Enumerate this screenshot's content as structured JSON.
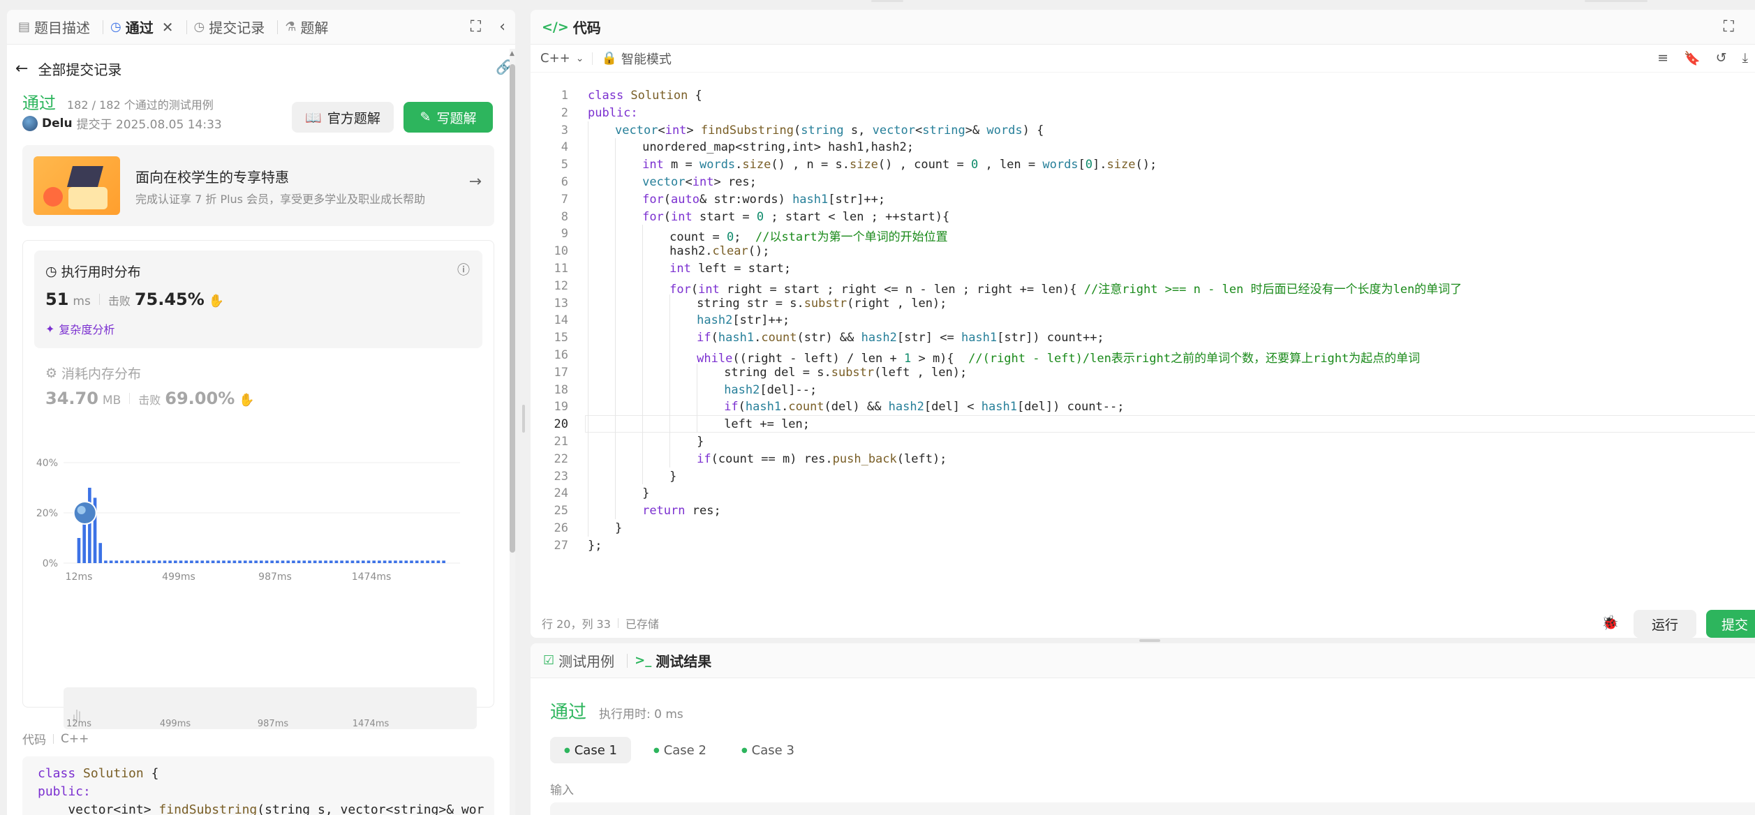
{
  "left": {
    "tabs": [
      {
        "label": "题目描述",
        "icon": "document-icon"
      },
      {
        "label": "通过",
        "icon": "history-icon",
        "active": true,
        "closable": true
      },
      {
        "label": "提交记录",
        "icon": "history-icon"
      },
      {
        "label": "题解",
        "icon": "flask-icon"
      }
    ],
    "back_label": "全部提交记录",
    "status": "通过",
    "cases_info": "182 / 182 个通过的测试用例",
    "user": "Delu",
    "submitted_at": "提交于 2025.08.05 14:33",
    "official_btn": "官方题解",
    "write_btn": "写题解",
    "promo": {
      "title": "面向在校学生的专享特惠",
      "subtitle": "完成认证享 7 折 Plus 会员，享受更多学业及职业成长帮助"
    },
    "runtime": {
      "title": "执行用时分布",
      "value": "51",
      "unit": "ms",
      "beat_label": "击败",
      "beat": "75.45%",
      "complexity_link": "复杂度分析"
    },
    "memory": {
      "title": "消耗内存分布",
      "value": "34.70",
      "unit": "MB",
      "beat_label": "击败",
      "beat": "69.00%"
    },
    "code_section_label": "代码",
    "code_section_lang": "C++",
    "preview": [
      [
        [
          "class ",
          "kw"
        ],
        [
          "Solution",
          "fn"
        ],
        [
          " {",
          ""
        ]
      ],
      [
        [
          "public:",
          "kw"
        ]
      ],
      [
        [
          "    vector<int> ",
          ""
        ],
        [
          "findSubstring",
          "fn"
        ],
        [
          "(string s, vector<string>& wor",
          ""
        ]
      ]
    ]
  },
  "chart_data": {
    "type": "bar",
    "title": "执行用时分布",
    "x_tick_labels": [
      "12ms",
      "499ms",
      "987ms",
      "1474ms"
    ],
    "y_tick_labels": [
      "40%",
      "20%",
      "0%"
    ],
    "ylim": [
      0,
      40
    ],
    "user_value_ms": 51,
    "bins": 70,
    "values": [
      0,
      10,
      18,
      30,
      26,
      8,
      1,
      1,
      1,
      1,
      1,
      1,
      1,
      1,
      1,
      1,
      1,
      1,
      1,
      1,
      1,
      1,
      1,
      1,
      1,
      1,
      1,
      1,
      1,
      1,
      1,
      1,
      1,
      1,
      1,
      1,
      1,
      1,
      1,
      1,
      1,
      1,
      1,
      1,
      1,
      1,
      1,
      1,
      1,
      1,
      1,
      1,
      1,
      1,
      1,
      1,
      1,
      1,
      1,
      1,
      1,
      1,
      1,
      1,
      1,
      1,
      1,
      1,
      1,
      1
    ],
    "overview_tick_labels": [
      "12ms",
      "499ms",
      "987ms",
      "1474ms"
    ],
    "accent_color": "#3c72e6"
  },
  "editor": {
    "title": "代码",
    "lang": "C++",
    "mode": "智能模式",
    "status_pos": "行 20，列 33",
    "status_saved": "已存储",
    "run_btn": "运行",
    "submit_btn": "提交",
    "active_line": 20,
    "lines": [
      {
        "indent": 0,
        "t": [
          [
            "class ",
            "kw"
          ],
          [
            "Solution",
            "fn"
          ],
          [
            " {",
            ""
          ]
        ]
      },
      {
        "indent": 0,
        "t": [
          [
            "public:",
            "kw"
          ]
        ]
      },
      {
        "indent": 1,
        "t": [
          [
            "vector",
            "ty"
          ],
          [
            "<",
            ""
          ],
          [
            "int",
            "kw"
          ],
          [
            "> ",
            ""
          ],
          [
            "findSubstring",
            "fn"
          ],
          [
            "(",
            ""
          ],
          [
            "string",
            "ty"
          ],
          [
            " s, ",
            ""
          ],
          [
            "vector",
            "ty"
          ],
          [
            "<",
            ""
          ],
          [
            "string",
            "ty"
          ],
          [
            ">& ",
            ""
          ],
          [
            "words",
            "ty"
          ],
          [
            ") {",
            ""
          ]
        ]
      },
      {
        "indent": 2,
        "t": [
          [
            "unordered_map<string,int> hash1,hash2;",
            ""
          ]
        ]
      },
      {
        "indent": 2,
        "t": [
          [
            "int",
            "kw"
          ],
          [
            " m = ",
            ""
          ],
          [
            "words",
            "ty"
          ],
          [
            ".",
            ""
          ],
          [
            "size",
            "fn"
          ],
          [
            "() , n = s.",
            ""
          ],
          [
            "size",
            "fn"
          ],
          [
            "() , count = ",
            ""
          ],
          [
            "0",
            "num"
          ],
          [
            " , len = ",
            ""
          ],
          [
            "words",
            "ty"
          ],
          [
            "[",
            ""
          ],
          [
            "0",
            "num"
          ],
          [
            "].",
            ""
          ],
          [
            "size",
            "fn"
          ],
          [
            "();",
            ""
          ]
        ]
      },
      {
        "indent": 2,
        "t": [
          [
            "vector",
            "ty"
          ],
          [
            "<",
            ""
          ],
          [
            "int",
            "kw"
          ],
          [
            "> res;",
            ""
          ]
        ]
      },
      {
        "indent": 2,
        "t": [
          [
            "for",
            "kw"
          ],
          [
            "(",
            ""
          ],
          [
            "auto",
            "kw"
          ],
          [
            "& str:words) ",
            ""
          ],
          [
            "hash1",
            "ty"
          ],
          [
            "[str]++;",
            ""
          ]
        ]
      },
      {
        "indent": 2,
        "t": [
          [
            "for",
            "kw"
          ],
          [
            "(",
            ""
          ],
          [
            "int",
            "kw"
          ],
          [
            " start = ",
            ""
          ],
          [
            "0",
            "num"
          ],
          [
            " ; start < len ; ++start){",
            ""
          ]
        ]
      },
      {
        "indent": 3,
        "t": [
          [
            "count = ",
            ""
          ],
          [
            "0",
            "num"
          ],
          [
            ";  ",
            ""
          ],
          [
            "//以start为第一个单词的开始位置",
            "cm"
          ]
        ]
      },
      {
        "indent": 3,
        "t": [
          [
            "hash2.",
            ""
          ],
          [
            "clear",
            "fn"
          ],
          [
            "();",
            ""
          ]
        ]
      },
      {
        "indent": 3,
        "t": [
          [
            "int",
            "kw"
          ],
          [
            " left = start;",
            ""
          ]
        ]
      },
      {
        "indent": 3,
        "t": [
          [
            "for",
            "kw"
          ],
          [
            "(",
            ""
          ],
          [
            "int",
            "kw"
          ],
          [
            " right = start ; right <= n - len ; right += len){ ",
            ""
          ],
          [
            "//注意right >== n - len 时后面已经没有一个长度为len的单词了",
            "cm"
          ]
        ]
      },
      {
        "indent": 4,
        "t": [
          [
            "string str = s.",
            ""
          ],
          [
            "substr",
            "fn"
          ],
          [
            "(right , len);",
            ""
          ]
        ]
      },
      {
        "indent": 4,
        "t": [
          [
            "hash2",
            "ty"
          ],
          [
            "[str]++;",
            ""
          ]
        ]
      },
      {
        "indent": 4,
        "t": [
          [
            "if",
            "kw"
          ],
          [
            "(",
            ""
          ],
          [
            "hash1",
            "ty"
          ],
          [
            ".",
            ""
          ],
          [
            "count",
            "fn"
          ],
          [
            "(str) && ",
            ""
          ],
          [
            "hash2",
            "ty"
          ],
          [
            "[str] <= ",
            ""
          ],
          [
            "hash1",
            "ty"
          ],
          [
            "[str]) count++;",
            ""
          ]
        ]
      },
      {
        "indent": 4,
        "t": [
          [
            "while",
            "kw"
          ],
          [
            "((right - left) / len + ",
            ""
          ],
          [
            "1",
            "num"
          ],
          [
            " > m){  ",
            ""
          ],
          [
            "//(right - left)/len表示right之前的单词个数，还要算上right为起点的单词",
            "cm"
          ]
        ]
      },
      {
        "indent": 5,
        "t": [
          [
            "string del = s.",
            ""
          ],
          [
            "substr",
            "fn"
          ],
          [
            "(left , len);",
            ""
          ]
        ]
      },
      {
        "indent": 5,
        "t": [
          [
            "hash2",
            "ty"
          ],
          [
            "[del]--;",
            ""
          ]
        ]
      },
      {
        "indent": 5,
        "t": [
          [
            "if",
            "kw"
          ],
          [
            "(",
            ""
          ],
          [
            "hash1",
            "ty"
          ],
          [
            ".",
            ""
          ],
          [
            "count",
            "fn"
          ],
          [
            "(del) && ",
            ""
          ],
          [
            "hash2",
            "ty"
          ],
          [
            "[del] < ",
            ""
          ],
          [
            "hash1",
            "ty"
          ],
          [
            "[del]) count--;",
            ""
          ]
        ]
      },
      {
        "indent": 5,
        "t": [
          [
            "left += len;",
            ""
          ]
        ]
      },
      {
        "indent": 4,
        "t": [
          [
            "}",
            ""
          ]
        ]
      },
      {
        "indent": 4,
        "t": [
          [
            "if",
            "kw"
          ],
          [
            "(count == m) res.",
            ""
          ],
          [
            "push_back",
            "fn"
          ],
          [
            "(left);",
            ""
          ]
        ]
      },
      {
        "indent": 3,
        "t": [
          [
            "}",
            ""
          ]
        ]
      },
      {
        "indent": 2,
        "t": [
          [
            "}",
            ""
          ]
        ]
      },
      {
        "indent": 2,
        "t": [
          [
            "return",
            "kw"
          ],
          [
            " res;",
            ""
          ]
        ]
      },
      {
        "indent": 1,
        "t": [
          [
            "}",
            ""
          ]
        ]
      },
      {
        "indent": 0,
        "t": [
          [
            "};",
            ""
          ]
        ]
      }
    ]
  },
  "results": {
    "tab_cases": "测试用例",
    "tab_results": "测试结果",
    "status": "通过",
    "runtime": "执行用时: 0 ms",
    "cases": [
      "Case 1",
      "Case 2",
      "Case 3"
    ],
    "input_label": "输入"
  },
  "colors": {
    "accent_green": "#2db55d",
    "primary_green": "#2db55d",
    "chart_blue": "#3c72e6"
  }
}
